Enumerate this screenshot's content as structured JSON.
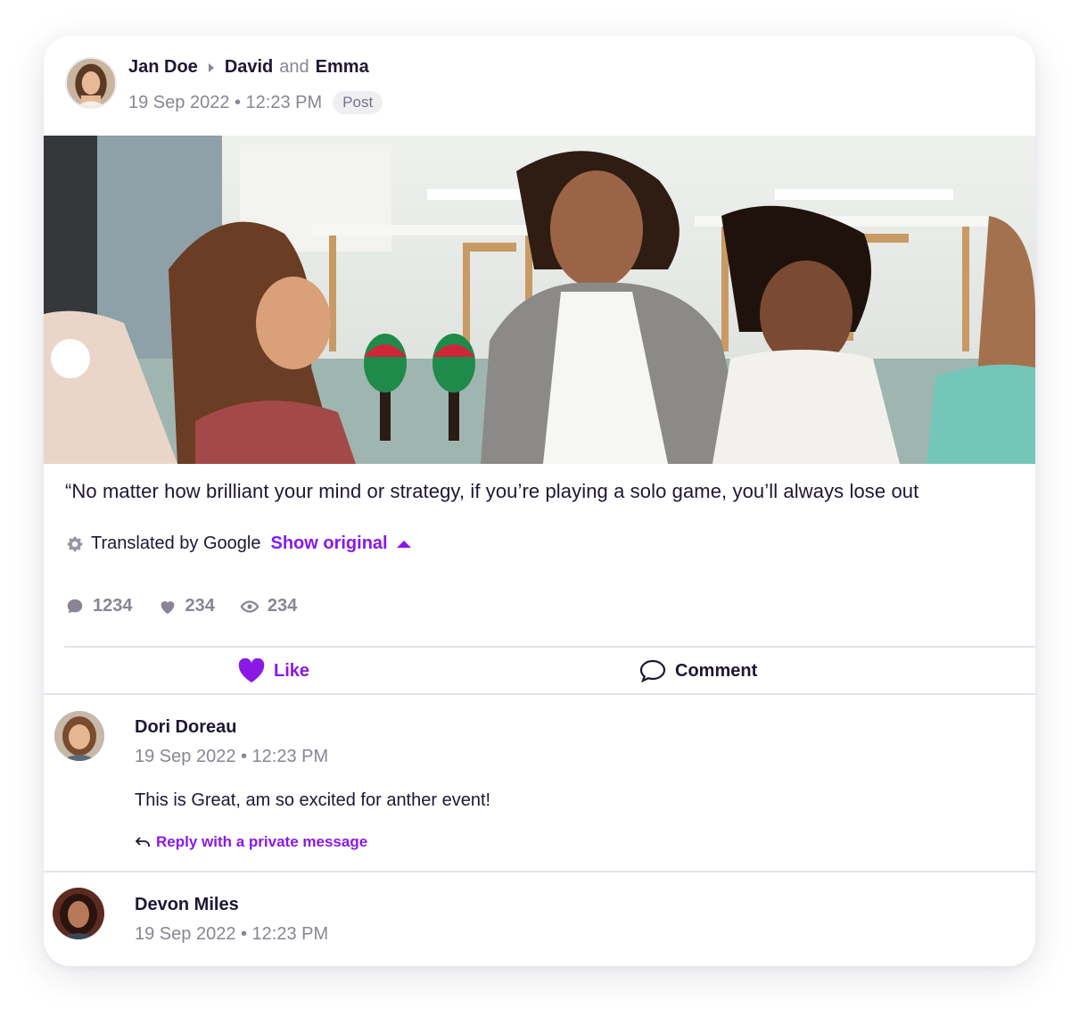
{
  "post": {
    "author": "Jan Doe",
    "recipient_1": "David",
    "conjunction": "and",
    "recipient_2": "Emma",
    "timestamp": "19 Sep 2022 • 12:23 PM",
    "badge": "Post",
    "quote": "“No matter how brilliant your mind or strategy, if you’re playing a solo game, you’ll always lose out",
    "translation": {
      "label": "Translated by Google",
      "link": "Show original"
    },
    "stats": {
      "comments": "1234",
      "likes": "234",
      "views": "234"
    },
    "actions": {
      "like_label": "Like",
      "comment_label": "Comment"
    }
  },
  "comments": [
    {
      "name": "Dori Doreau",
      "timestamp": "19 Sep 2022 • 12:23 PM",
      "text": "This is Great, am so excited for anther event!",
      "reply_label": "Reply with a private message"
    },
    {
      "name": "Devon Miles",
      "timestamp": "19 Sep 2022 • 12:23 PM"
    }
  ],
  "colors": {
    "accent": "#8a19e6",
    "text": "#1f1633",
    "muted": "#8a8494",
    "divider": "#e4e3ea"
  },
  "icons": {
    "stat_comments": "speech-bubble-icon",
    "stat_likes": "heart-icon",
    "stat_views": "eye-icon",
    "translate": "gear-icon",
    "reply": "reply-arrow-icon"
  }
}
